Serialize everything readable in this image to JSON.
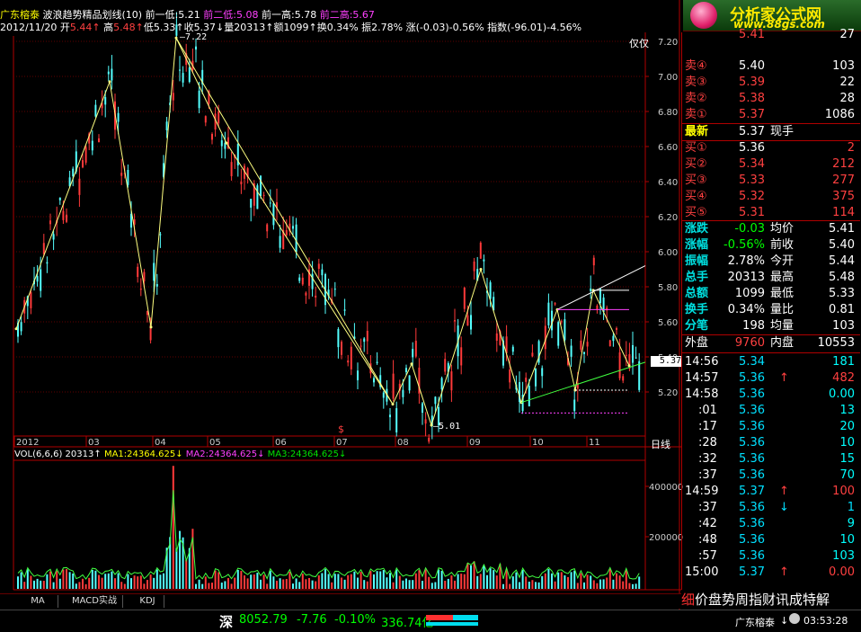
{
  "header": {
    "stock_name": "广东榕泰",
    "indicator": "波浪趋势精品划线(10)",
    "items1": [
      {
        "label": "前一低:",
        "value": "5.21",
        "color": "white"
      },
      {
        "label": "前二低:",
        "value": "5.08",
        "color": "magenta"
      },
      {
        "label": "前一高:",
        "value": "5.78",
        "color": "white"
      },
      {
        "label": "前二高:",
        "value": "5.67",
        "color": "magenta"
      }
    ],
    "line2": {
      "date": "2012/11/20",
      "open_label": "开",
      "open": "5.44",
      "open_arrow": "↑",
      "high_label": "高",
      "high": "5.48",
      "high_arrow": "↑",
      "low_label": "低",
      "low": "5.33",
      "low_arrow": "↑",
      "close_label": "收",
      "close": "5.37",
      "close_arrow": "↓",
      "vol_label": "量",
      "vol": "20313",
      "vol_arrow": "↑",
      "amt_label": "额",
      "amt": "1099",
      "amt_arrow": "↑",
      "turn_label": "换",
      "turn": "0.34%",
      "amp_label": "振",
      "amp": "2.78%",
      "chg_label": "涨",
      "chg": "(-0.03)-0.56%",
      "idx_label": "指数",
      "idx": "(-96.01)-4.56%"
    }
  },
  "chart": {
    "price_ticks": [
      "7.20",
      "7.00",
      "6.80",
      "6.60",
      "6.40",
      "6.20",
      "6.00",
      "5.80",
      "5.60",
      "5.40",
      "5.20"
    ],
    "peak_label": "7.22",
    "low_label": "5.01",
    "cur_price_tag": "5.37",
    "only_label": "仅仅",
    "months": [
      "2012",
      "03",
      "04",
      "05",
      "06",
      "07",
      "08",
      "09",
      "10",
      "11"
    ],
    "period": "日线",
    "vol_ticks": [
      "400000",
      "200000"
    ],
    "ma_colors": {
      "zigzag": "#ffff80",
      "green_line": "#40ff40",
      "magenta": "#ff40ff",
      "white": "#ffffff"
    }
  },
  "volume": {
    "title": "VOL(6,6,6)",
    "value": "20313",
    "ma1_label": "MA1:24364.625",
    "ma2_label": "MA2:24364.625",
    "ma3_label": "MA3:24364.625"
  },
  "tabs": [
    "MA",
    "MACD实战",
    "KDJ"
  ],
  "logo": {
    "title": "分析家公式网",
    "url": "www.88gs.com"
  },
  "quote": {
    "partial_top": [
      "5.41",
      "27"
    ],
    "sells": [
      {
        "label": "卖④",
        "price": "5.40",
        "vol": "103"
      },
      {
        "label": "卖③",
        "price": "5.39",
        "vol": "22"
      },
      {
        "label": "卖②",
        "price": "5.38",
        "vol": "28"
      },
      {
        "label": "卖①",
        "price": "5.37",
        "vol": "1086"
      }
    ],
    "latest_label": "最新",
    "latest_price": "5.37",
    "latest_hand": "现手",
    "buys": [
      {
        "label": "买①",
        "price": "5.36",
        "vol": "2"
      },
      {
        "label": "买②",
        "price": "5.34",
        "vol": "212"
      },
      {
        "label": "买③",
        "price": "5.33",
        "vol": "277"
      },
      {
        "label": "买④",
        "price": "5.32",
        "vol": "375"
      },
      {
        "label": "买⑤",
        "price": "5.31",
        "vol": "114"
      }
    ],
    "stats": [
      {
        "l1": "涨跌",
        "v1": "-0.03",
        "l2": "均价",
        "v2": "5.41"
      },
      {
        "l1": "涨幅",
        "v1": "-0.56%",
        "l2": "前收",
        "v2": "5.40"
      },
      {
        "l1": "振幅",
        "v1": "2.78%",
        "l2": "今开",
        "v2": "5.44"
      },
      {
        "l1": "总手",
        "v1": "20313",
        "l2": "最高",
        "v2": "5.48"
      },
      {
        "l1": "总额",
        "v1": "1099",
        "l2": "最低",
        "v2": "5.33"
      },
      {
        "l1": "换手",
        "v1": "0.34%",
        "l2": "量比",
        "v2": "0.81"
      },
      {
        "l1": "分笔",
        "v1": "198",
        "l2": "均量",
        "v2": "103"
      }
    ],
    "outer_label": "外盘",
    "outer": "9760",
    "inner_label": "内盘",
    "inner": "10553"
  },
  "ticks": [
    {
      "time": "14:56",
      "price": "5.34",
      "arrow": "",
      "vol": "181"
    },
    {
      "time": "14:57",
      "price": "5.36",
      "arrow": "↑",
      "vol": "482"
    },
    {
      "time": "14:58",
      "price": "5.36",
      "arrow": "",
      "vol": "0.00"
    },
    {
      "time": ":01",
      "price": "5.36",
      "arrow": "",
      "vol": "13"
    },
    {
      "time": ":17",
      "price": "5.36",
      "arrow": "",
      "vol": "20"
    },
    {
      "time": ":28",
      "price": "5.36",
      "arrow": "",
      "vol": "10"
    },
    {
      "time": ":32",
      "price": "5.36",
      "arrow": "",
      "vol": "15"
    },
    {
      "time": ":37",
      "price": "5.36",
      "arrow": "",
      "vol": "70"
    },
    {
      "time": "14:59",
      "price": "5.37",
      "arrow": "↑",
      "vol": "100"
    },
    {
      "time": ":37",
      "price": "5.36",
      "arrow": "↓",
      "vol": "1"
    },
    {
      "time": ":42",
      "price": "5.36",
      "arrow": "",
      "vol": "9"
    },
    {
      "time": ":48",
      "price": "5.36",
      "arrow": "",
      "vol": "10"
    },
    {
      "time": ":57",
      "price": "5.36",
      "arrow": "",
      "vol": "103"
    },
    {
      "time": "15:00",
      "price": "5.37",
      "arrow": "↑",
      "vol": "0.00"
    }
  ],
  "bottom_right": {
    "text": "细价盘势周指财讯成特解"
  },
  "status": {
    "market": "深",
    "index": "8052.79",
    "change": "-7.76",
    "pct": "-0.10%",
    "amount": "336.74亿",
    "stock": "广东榕泰",
    "time": "03:53:28"
  }
}
